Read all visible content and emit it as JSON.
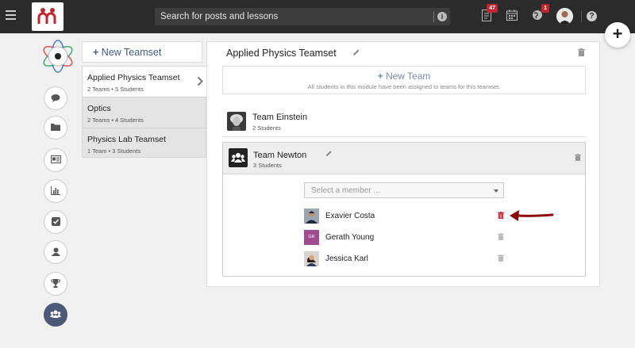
{
  "header": {
    "search_placeholder": "Search for posts and lessons",
    "posts_badge": "47",
    "notifications_badge": "1"
  },
  "fab_label": "+",
  "sidebar": {
    "active_item": "teams",
    "items": [
      "messages",
      "folders",
      "cards",
      "analytics",
      "tasks",
      "profile",
      "awards",
      "teams"
    ]
  },
  "teamsets": {
    "new_label": "New Teamset",
    "items": [
      {
        "name": "Applied Physics Teamset",
        "meta": "2 Teams • 5 Students",
        "selected": true
      },
      {
        "name": "Optics",
        "meta": "2 Teams • 4 Students",
        "selected": false
      },
      {
        "name": "Physics Lab Teamset",
        "meta": "1 Team • 3 Students",
        "selected": false
      }
    ]
  },
  "main": {
    "title": "Applied Physics Teamset",
    "new_team_label": "New Team",
    "new_team_note": "All students in this module have been assigned to teams for this teamset.",
    "teams": [
      {
        "name": "Team Einstein",
        "meta": "2 Students"
      },
      {
        "name": "Team Newton",
        "meta": "3 Students",
        "expanded": true
      }
    ],
    "member_select_placeholder": "Select a member ...",
    "members": [
      {
        "name": "Exavier Costa",
        "avatar": "photo",
        "highlight_trash": true
      },
      {
        "name": "Gerath Young",
        "avatar": "initials",
        "initials": "GR"
      },
      {
        "name": "Jessica Karl",
        "avatar": "photo"
      }
    ]
  },
  "colors": {
    "topbar": "#2b2b2b",
    "accent_blue": "#405a82",
    "badge_red": "#c0262d",
    "delete_red": "#c42330",
    "arrow_red": "#8b0a0a",
    "active_rail": "#4c5a7a",
    "initials_bg": "#a04b93"
  }
}
